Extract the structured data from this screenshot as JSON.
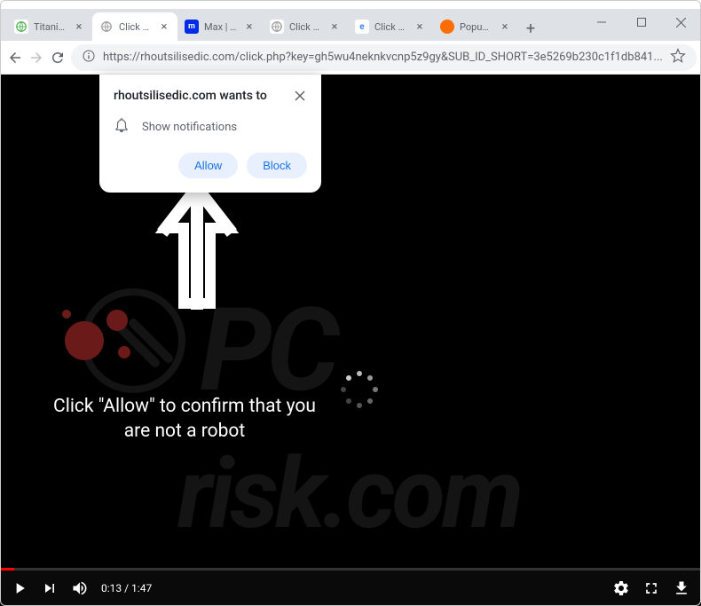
{
  "tabs": [
    {
      "title": "Titanic (",
      "favicon_bg": "#4caf50",
      "favicon_text": ""
    },
    {
      "title": "Click All",
      "favicon_bg": "#e8eaed",
      "favicon_text": "",
      "active": true
    },
    {
      "title": "Max | Th",
      "favicon_bg": "#002be7",
      "favicon_text": "m"
    },
    {
      "title": "Click &c",
      "favicon_bg": "#e8eaed",
      "favicon_text": ""
    },
    {
      "title": "Click All",
      "favicon_bg": "#4285f4",
      "favicon_text": "e"
    },
    {
      "title": "Popup B",
      "favicon_bg": "#ff6d00",
      "favicon_text": ""
    }
  ],
  "address": {
    "url": "https://rhoutsilisedic.com/click.php?key=gh5wu4neknkvcnp5z9gy&SUB_ID_SHORT=3e5269b230c1f1db841..."
  },
  "notification": {
    "title": "rhoutsilisedic.com wants to",
    "body": "Show notifications",
    "allow": "Allow",
    "block": "Block"
  },
  "main_text": "Click \"Allow\" to confirm that you are not a robot",
  "video": {
    "current_time": "0:13",
    "duration": "1:47"
  },
  "watermark": "PCrisk.com"
}
